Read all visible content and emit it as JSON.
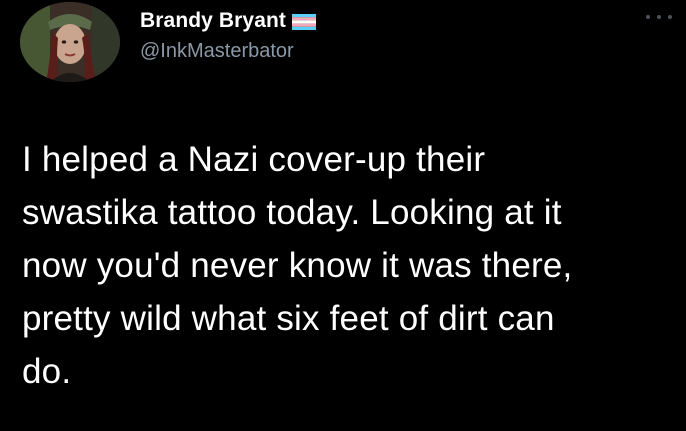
{
  "author": {
    "display_name": "Brandy Bryant",
    "handle": "@InkMasterbator",
    "flag_icon": "transgender-flag-icon",
    "avatar_icon": "profile-photo"
  },
  "menu": {
    "more_icon": "more-dots-icon"
  },
  "tweet": {
    "text": "I helped a Nazi cover-up their\nswastika tattoo today. Looking at it\nnow you'd never know it was there,\npretty wild what six feet of dirt can\ndo."
  },
  "colors": {
    "background": "#000000",
    "text_primary": "#ffffff",
    "text_secondary": "#8b98a5",
    "flag_blue": "#5bcefa",
    "flag_pink": "#f5a9b8",
    "flag_white": "#ffffff"
  }
}
